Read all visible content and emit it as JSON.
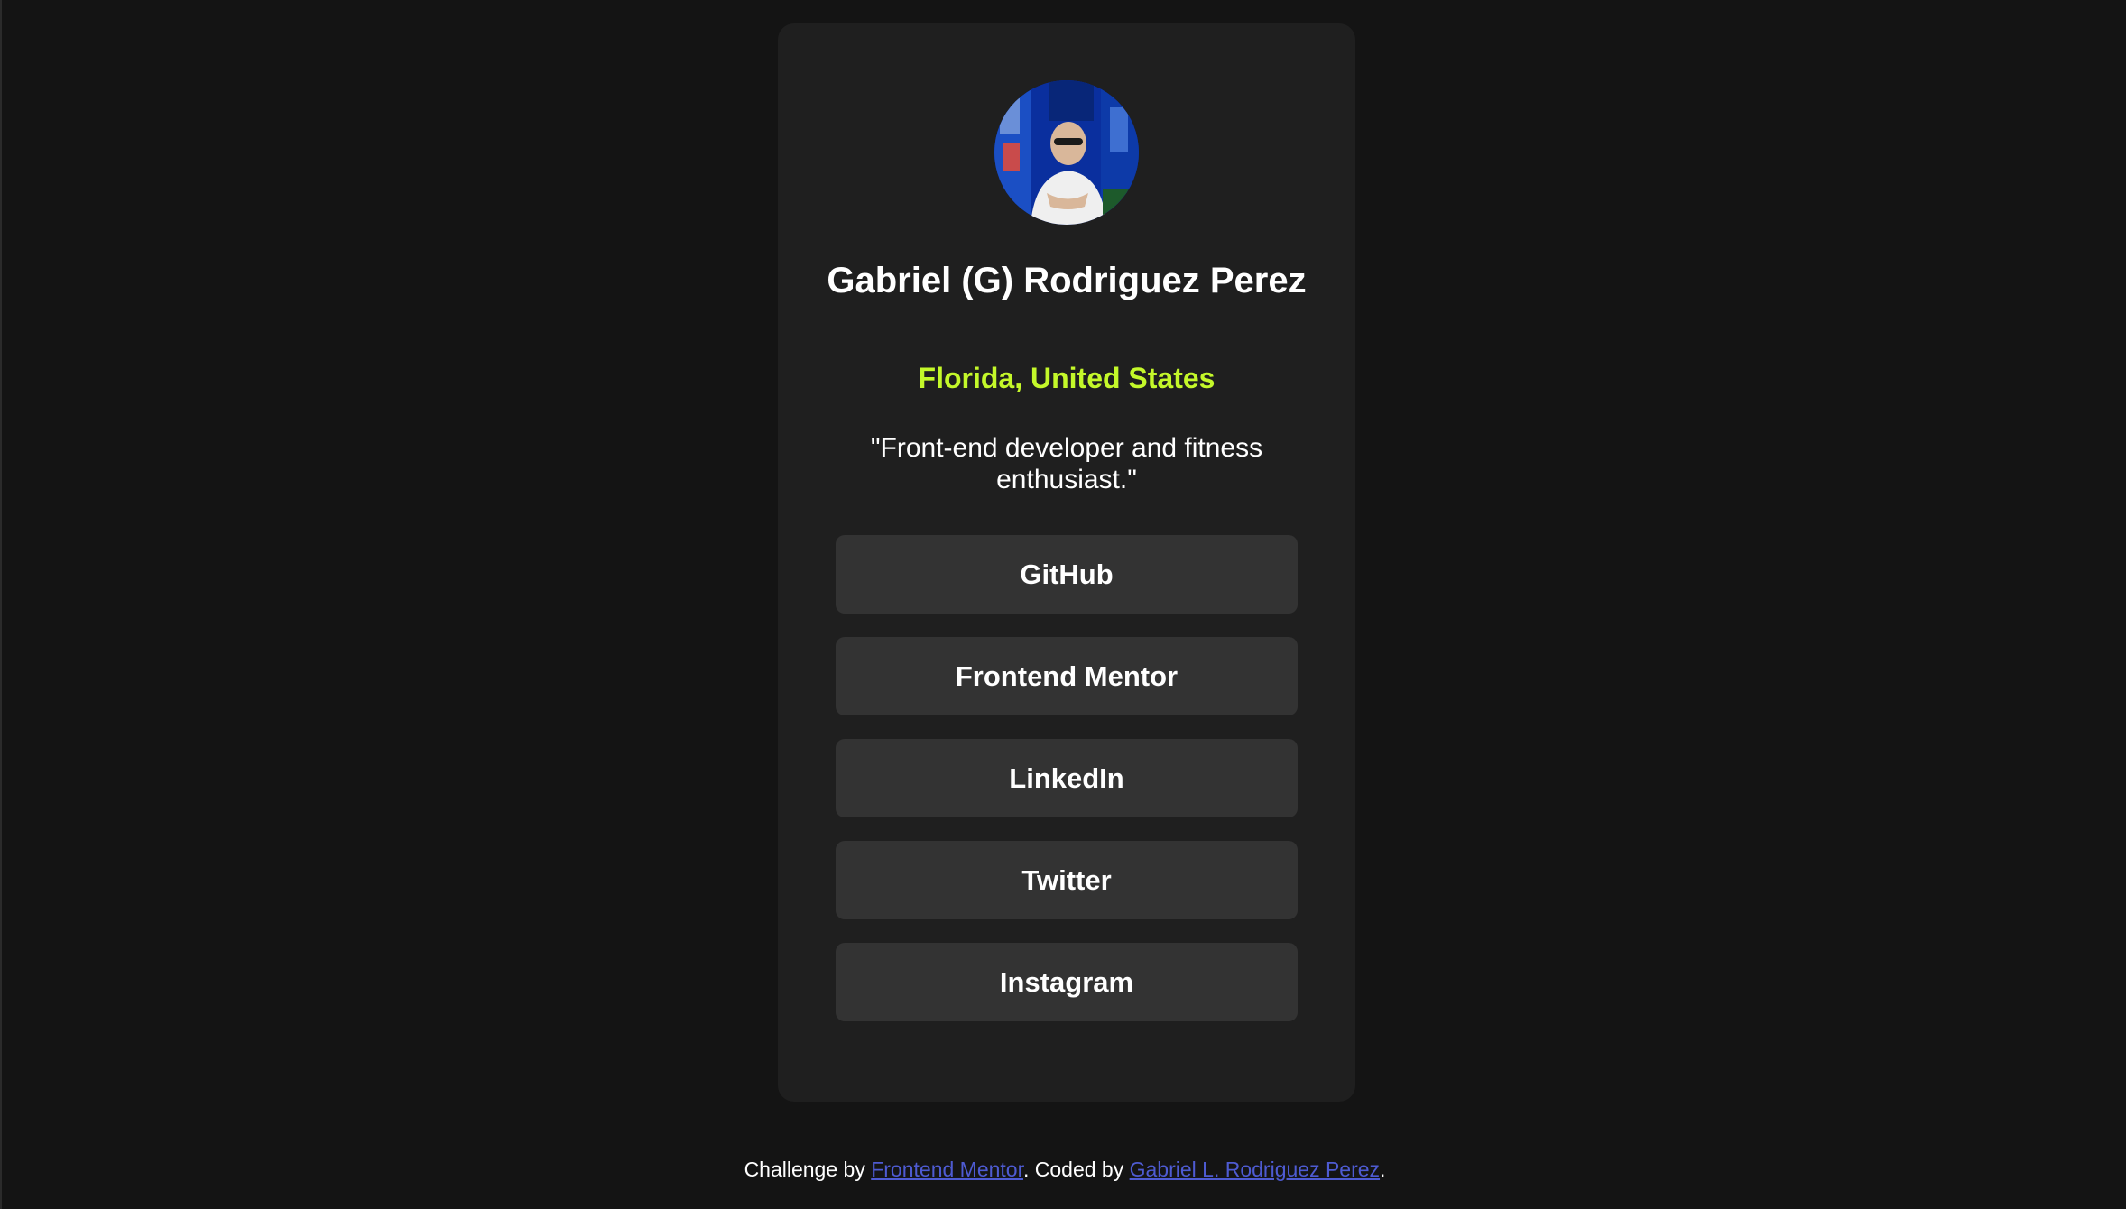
{
  "profile": {
    "avatar_icon": "profile-photo",
    "name": "Gabriel (G) Rodriguez Perez",
    "location": "Florida, United States",
    "bio": "\"Front-end developer and fitness enthusiast.\""
  },
  "links": [
    {
      "label": "GitHub"
    },
    {
      "label": "Frontend Mentor"
    },
    {
      "label": "LinkedIn"
    },
    {
      "label": "Twitter"
    },
    {
      "label": "Instagram"
    }
  ],
  "footer": {
    "prefix": "Challenge by ",
    "challenge_link": "Frontend Mentor",
    "middle": ". Coded by ",
    "author_link": "Gabriel L. Rodriguez Perez",
    "suffix": "."
  },
  "colors": {
    "background": "#141414",
    "card": "#1f1f1f",
    "button": "#333333",
    "accent": "#c4f82a",
    "link": "#4e5bd2"
  }
}
